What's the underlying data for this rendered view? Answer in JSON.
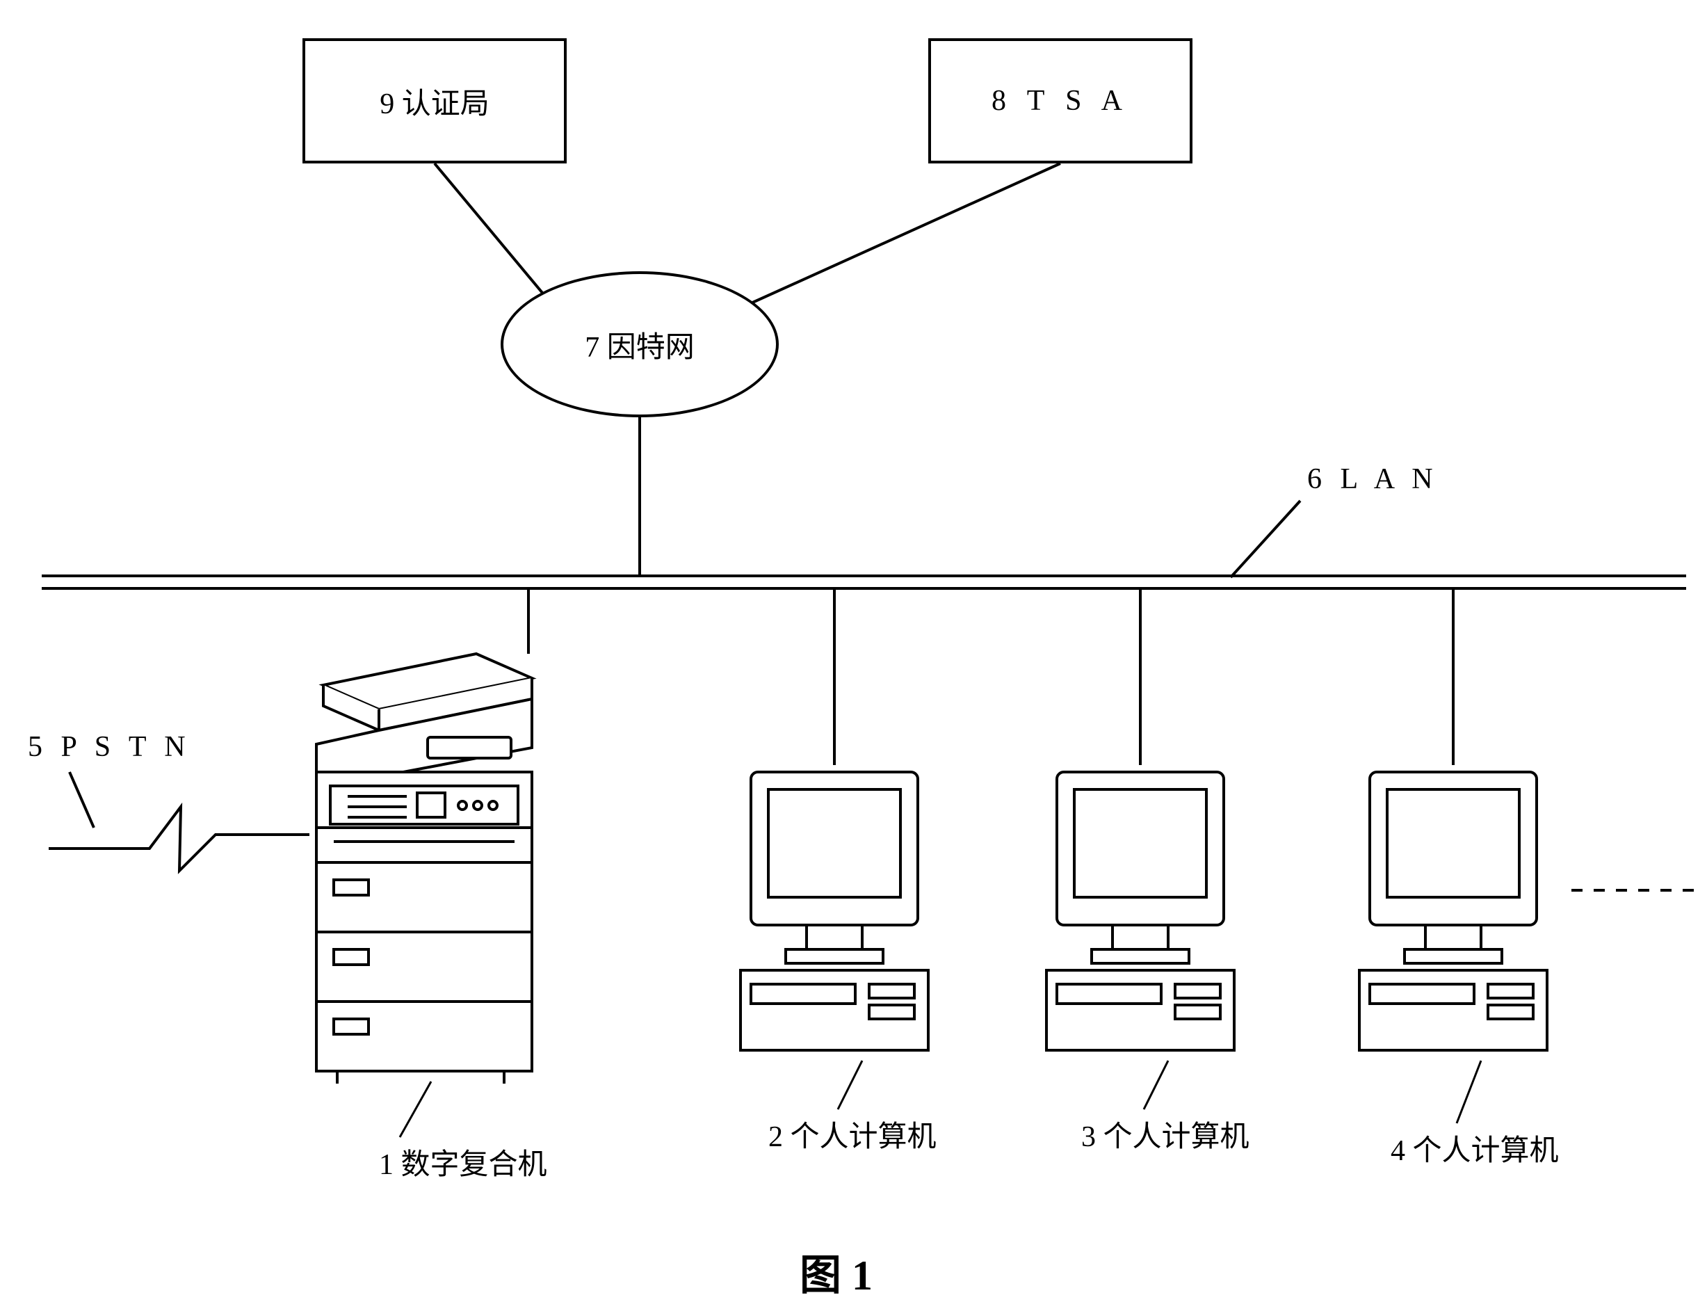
{
  "boxes": {
    "ca": "9 认证局",
    "tsa": "8 T S A"
  },
  "ellipse": "7 因特网",
  "labels": {
    "lan": "6 L A N",
    "pstn": "5 P S T N",
    "mfp": "1 数字复合机",
    "pc2": "2 个人计算机",
    "pc3": "3 个人计算机",
    "pc4": "4 个人计算机"
  },
  "figure": "图 1"
}
